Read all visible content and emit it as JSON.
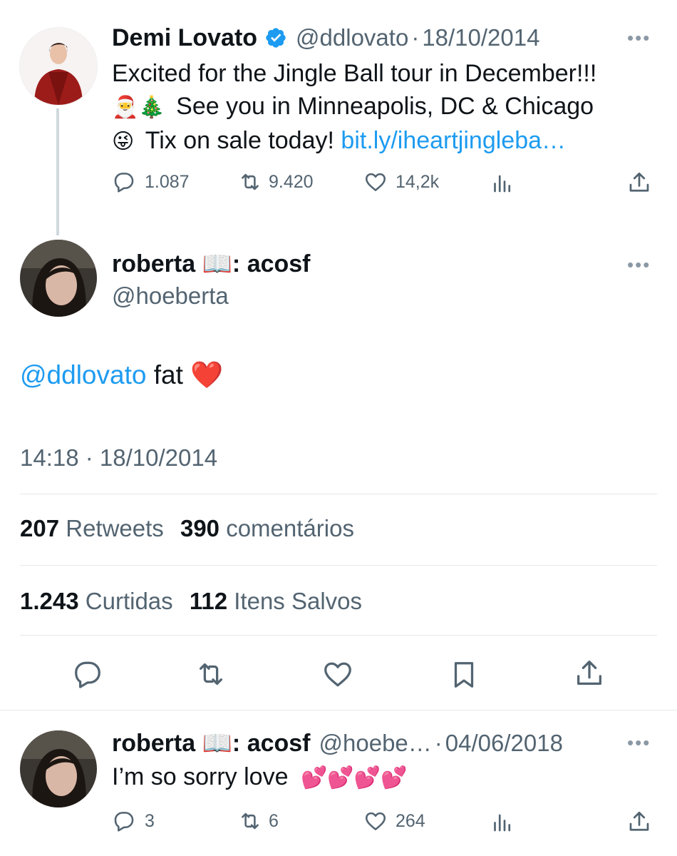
{
  "tweet1": {
    "name": "Demi Lovato",
    "handle": "@ddlovato",
    "separator": "·",
    "date": "18/10/2014",
    "line1": "Excited for the Jingle Ball tour in December!!!",
    "line2_emoji": "🎅🎄",
    "line2_text": "See you in Minneapolis, DC & Chicago",
    "line3_emoji": "😜",
    "line3_text": "Tix on sale today!",
    "link": "bit.ly/iheartjingleba…",
    "replies": "1.087",
    "retweets": "9.420",
    "likes": "14,2k"
  },
  "main": {
    "name": "roberta 📖: acosf",
    "handle": "@hoeberta",
    "mention": "@ddlovato",
    "text": "fat",
    "emoji": "❤️",
    "timestamp": "14:18 · 18/10/2014",
    "retweets_count": "207",
    "retweets_label": "Retweets",
    "comments_count": "390",
    "comments_label": "comentários",
    "likes_count": "1.243",
    "likes_label": "Curtidas",
    "saves_count": "112",
    "saves_label": "Itens Salvos"
  },
  "reply": {
    "name": "roberta 📖: acosf",
    "handle": "@hoebe…",
    "separator": "·",
    "date": "04/06/2018",
    "text": "I’m so sorry love",
    "emoji": "💕💕💕💕",
    "replies": "3",
    "retweets": "6",
    "likes": "264"
  },
  "more_label": "•••",
  "colors": {
    "accent": "#1d9bf0",
    "verified": "#1d9bf0",
    "text": "#0f1419",
    "muted": "#536471"
  }
}
